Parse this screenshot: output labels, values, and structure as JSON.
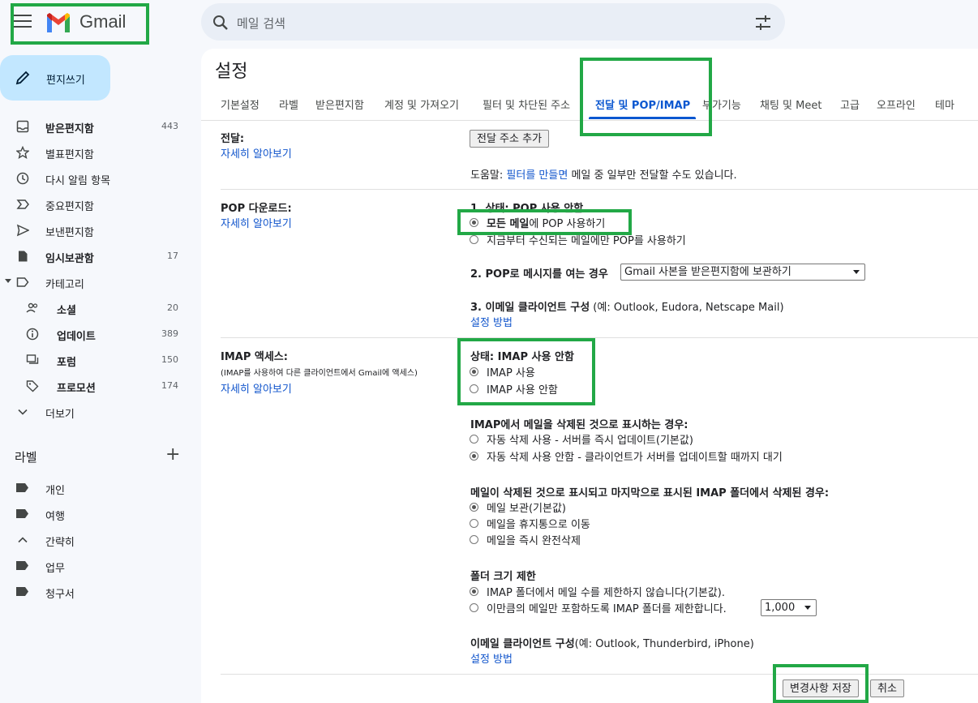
{
  "header": {
    "brand": "Gmail",
    "search_placeholder": "메일 검색"
  },
  "sidebar": {
    "compose": "편지쓰기",
    "items": [
      {
        "label": "받은편지함",
        "count": "443"
      },
      {
        "label": "별표편지함",
        "count": ""
      },
      {
        "label": "다시 알림 항목",
        "count": ""
      },
      {
        "label": "중요편지함",
        "count": ""
      },
      {
        "label": "보낸편지함",
        "count": ""
      },
      {
        "label": "임시보관함",
        "count": "17"
      },
      {
        "label": "카테고리",
        "count": ""
      },
      {
        "label": "소셜",
        "count": "20"
      },
      {
        "label": "업데이트",
        "count": "389"
      },
      {
        "label": "포럼",
        "count": "150"
      },
      {
        "label": "프로모션",
        "count": "174"
      },
      {
        "label": "더보기",
        "count": ""
      }
    ],
    "labels_heading": "라벨",
    "add_label": "+",
    "labels": [
      "개인",
      "여행",
      "간략히",
      "업무",
      "청구서"
    ]
  },
  "settings": {
    "title": "설정",
    "tabs": [
      "기본설정",
      "라벨",
      "받은편지함",
      "계정 및 가져오기",
      "필터 및 차단된 주소",
      "전달 및 POP/IMAP",
      "부가기능",
      "채팅 및 Meet",
      "고급",
      "오프라인",
      "테마"
    ],
    "forwarding": {
      "title": "전달:",
      "learn_more": "자세히 알아보기",
      "add_button": "전달 주소 추가",
      "tip_prefix": "도움말: ",
      "tip_link": "필터를 만들면",
      "tip_suffix": " 메일 중 일부만 전달할 수도 있습니다."
    },
    "pop": {
      "title": "POP 다운로드:",
      "learn_more": "자세히 알아보기",
      "status_label": "1. 상태: POP 사용 안함",
      "option_all_bold": "모든 메일",
      "option_all_rest": "에 POP 사용하기",
      "option_new": "지금부터 수신되는 메일에만 POP를 사용하기",
      "when_label": "2. POP로 메시지를 여는 경우",
      "when_select": "Gmail 사본을 받은편지함에 보관하기",
      "client_label": "3. 이메일 클라이언트 구성",
      "client_note": " (예: Outlook, Eudora, Netscape Mail)",
      "setup_link": "설정 방법"
    },
    "imap": {
      "title": "IMAP 액세스:",
      "note": "(IMAP를 사용하여 다른 클라이언트에서 Gmail에 액세스)",
      "learn_more": "자세히 알아보기",
      "status_label": "상태: IMAP 사용 안함",
      "enable": "IMAP 사용",
      "disable": "IMAP 사용 안함",
      "deleted_label": "IMAP에서 메일을 삭제된 것으로 표시하는 경우:",
      "auto_expunge_on": "자동 삭제 사용 - 서버를 즉시 업데이트(기본값)",
      "auto_expunge_off": "자동 삭제 사용 안함 - 클라이언트가 서버를 업데이트할 때까지 대기",
      "expunged_label": "메일이 삭제된 것으로 표시되고 마지막으로 표시된 IMAP 폴더에서 삭제된 경우:",
      "archive": "메일 보관(기본값)",
      "trash": "메일을 휴지통으로 이동",
      "delete_forever": "메일을 즉시 완전삭제",
      "folder_label": "폴더 크기 제한",
      "no_limit": "IMAP 폴더에서 메일 수를 제한하지 않습니다(기본값).",
      "limit": "이만큼의 메일만 포함하도록 IMAP 폴더를 제한합니다.",
      "limit_value": "1,000",
      "client_label": "이메일 클라이언트 구성",
      "client_note": "(예: Outlook, Thunderbird, iPhone)",
      "setup_link": "설정 방법"
    },
    "save_button": "변경사항 저장",
    "cancel_button": "취소"
  },
  "colors": {
    "accent": "#0b57d0",
    "compose_bg": "#c2e7ff",
    "highlight": "#22a846"
  }
}
